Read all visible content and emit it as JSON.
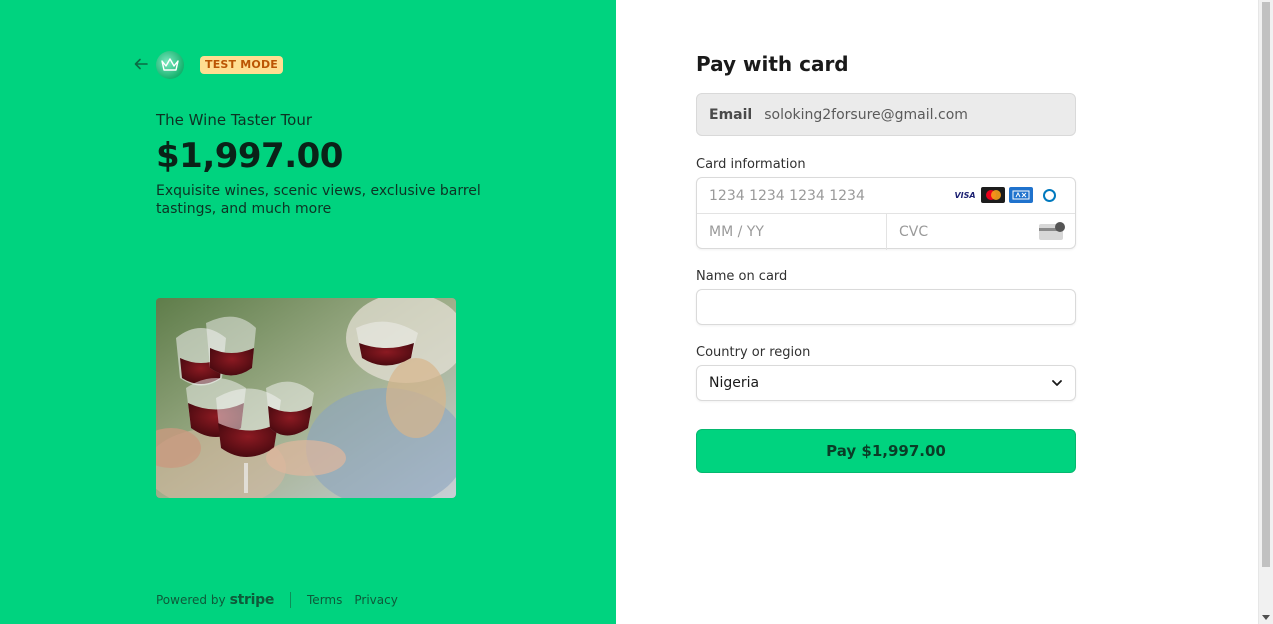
{
  "summary": {
    "back_icon": "arrow-left-icon",
    "logo_icon": "crown-logo-icon",
    "test_mode": "TEST MODE",
    "product_name": "The Wine Taster Tour",
    "price": "$1,997.00",
    "description": "Exquisite wines, scenic views, exclusive barrel tastings, and much more"
  },
  "footer": {
    "powered_by": "Powered by",
    "brand": "stripe",
    "terms": "Terms",
    "privacy": "Privacy"
  },
  "payment": {
    "title": "Pay with card",
    "email_label": "Email",
    "email_value": "soloking2forsure@gmail.com",
    "card_label": "Card information",
    "card_number_placeholder": "1234 1234 1234 1234",
    "card_brands": [
      "VISA",
      "mastercard",
      "amex",
      "diners"
    ],
    "expiry_placeholder": "MM / YY",
    "cvc_placeholder": "CVC",
    "name_label": "Name on card",
    "name_value": "",
    "country_label": "Country or region",
    "country_value": "Nigeria",
    "pay_button": "Pay $1,997.00"
  },
  "colors": {
    "brand_green": "#00d37f",
    "badge_bg": "#ffde92",
    "badge_text": "#bb5504"
  }
}
